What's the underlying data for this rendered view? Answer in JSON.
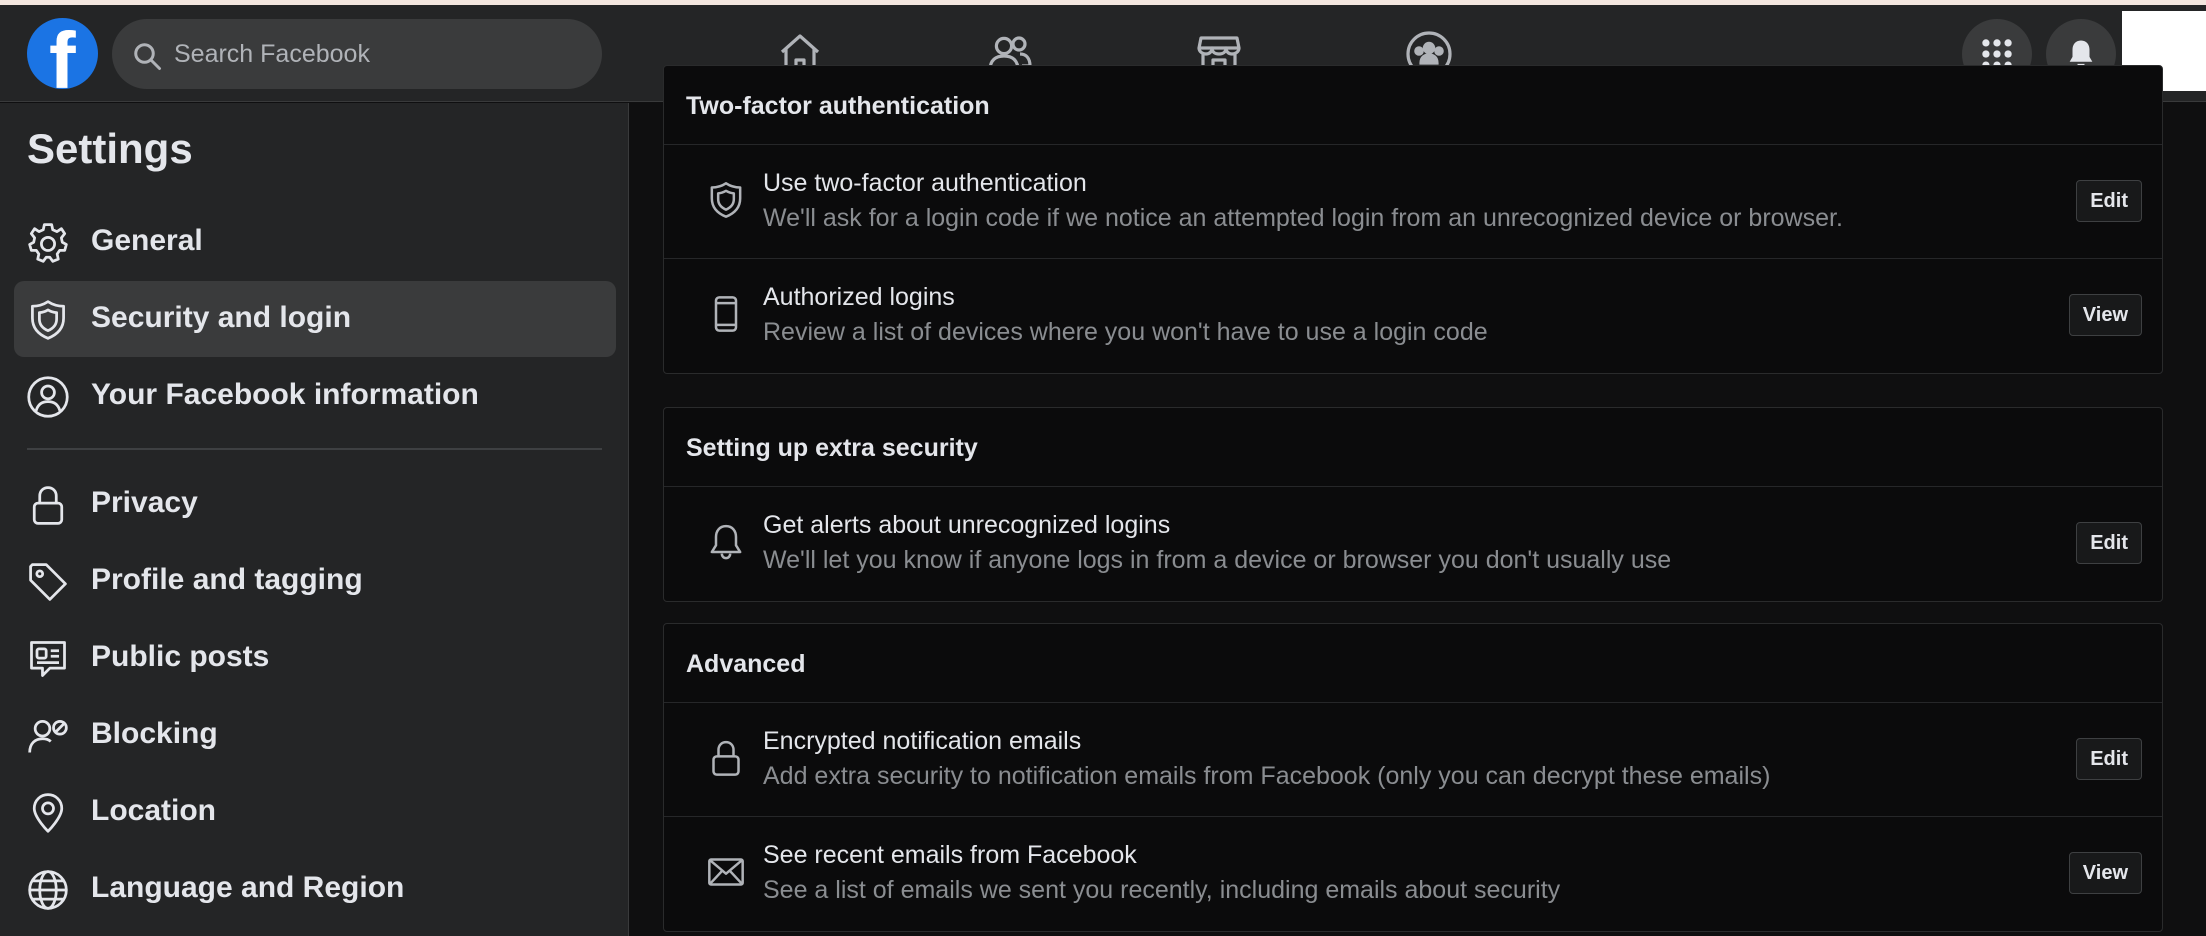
{
  "header": {
    "search_placeholder": "Search Facebook",
    "logo_letter": "f",
    "nav_tabs": [
      "home-icon",
      "friends-icon",
      "marketplace-icon",
      "groups-icon"
    ],
    "accent_color": "#1b74e4"
  },
  "sidebar": {
    "title": "Settings",
    "items": [
      {
        "label": "General",
        "icon": "gear-icon",
        "active": false
      },
      {
        "label": "Security and login",
        "icon": "shield-icon",
        "active": true
      },
      {
        "label": "Your Facebook information",
        "icon": "person-icon",
        "active": false
      },
      {
        "label": "Privacy",
        "icon": "lock-icon",
        "active": false
      },
      {
        "label": "Profile and tagging",
        "icon": "tag-icon",
        "active": false
      },
      {
        "label": "Public posts",
        "icon": "public-posts-icon",
        "active": false
      },
      {
        "label": "Blocking",
        "icon": "blocking-icon",
        "active": false
      },
      {
        "label": "Location",
        "icon": "location-pin-icon",
        "active": false
      },
      {
        "label": "Language and Region",
        "icon": "globe-icon",
        "active": false
      }
    ]
  },
  "main": {
    "sections": [
      {
        "heading": "Two-factor authentication",
        "rows": [
          {
            "title": "Use two-factor authentication",
            "description": "We'll ask for a login code if we notice an attempted login from an unrecognized device or browser.",
            "button": "Edit",
            "icon": "shield-icon"
          },
          {
            "title": "Authorized logins",
            "description": "Review a list of devices where you won't have to use a login code",
            "button": "View",
            "icon": "phone-icon"
          }
        ]
      },
      {
        "heading": "Setting up extra security",
        "rows": [
          {
            "title": "Get alerts about unrecognized logins",
            "description": "We'll let you know if anyone logs in from a device or browser you don't usually use",
            "button": "Edit",
            "icon": "bell-icon"
          }
        ]
      },
      {
        "heading": "Advanced",
        "rows": [
          {
            "title": "Encrypted notification emails",
            "description": "Add extra security to notification emails from Facebook (only you can decrypt these emails)",
            "button": "Edit",
            "icon": "lock-icon"
          },
          {
            "title": "See recent emails from Facebook",
            "description": "See a list of emails we sent you recently, including emails about security",
            "button": "View",
            "icon": "envelope-icon"
          }
        ]
      }
    ]
  }
}
